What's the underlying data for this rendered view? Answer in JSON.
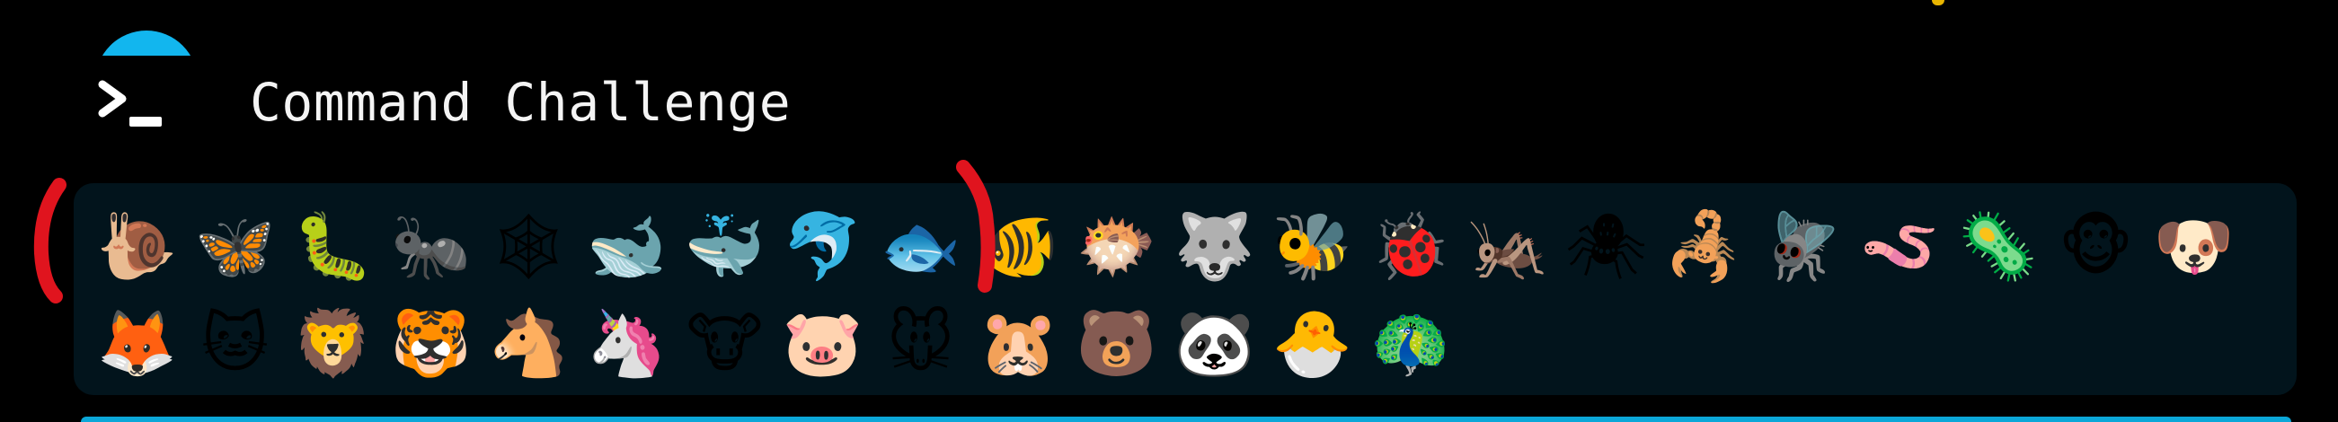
{
  "app": {
    "title": "Command Challenge",
    "icon": "terminal-prompt-icon"
  },
  "emoji_panel": {
    "row1": [
      {
        "name": "snail",
        "glyph": "🐌"
      },
      {
        "name": "butterfly",
        "glyph": "🦋"
      },
      {
        "name": "caterpillar",
        "glyph": "🐛"
      },
      {
        "name": "ant",
        "glyph": "🐜"
      },
      {
        "name": "spider-web",
        "glyph": "🕸"
      },
      {
        "name": "whale",
        "glyph": "🐋"
      },
      {
        "name": "spouting-whale",
        "glyph": "🐳"
      },
      {
        "name": "dolphin",
        "glyph": "🐬"
      },
      {
        "name": "fish",
        "glyph": "🐟"
      },
      {
        "name": "tropical-fish",
        "glyph": "🐠"
      },
      {
        "name": "blowfish",
        "glyph": "🐡"
      },
      {
        "name": "wolf",
        "glyph": "🐺"
      },
      {
        "name": "bee",
        "glyph": "🐝"
      },
      {
        "name": "ladybug",
        "glyph": "🐞"
      },
      {
        "name": "cricket",
        "glyph": "🦗"
      },
      {
        "name": "spider",
        "glyph": "🕷"
      },
      {
        "name": "scorpion",
        "glyph": "🦂"
      },
      {
        "name": "fly",
        "glyph": "🪰"
      },
      {
        "name": "worm",
        "glyph": "🪱"
      },
      {
        "name": "microbe",
        "glyph": "🦠"
      },
      {
        "name": "monkey-face",
        "glyph": "🐵"
      },
      {
        "name": "dog-face",
        "glyph": "🐶"
      }
    ],
    "row2": [
      {
        "name": "fox",
        "glyph": "🦊"
      },
      {
        "name": "cat-face",
        "glyph": "🐱"
      },
      {
        "name": "lion",
        "glyph": "🦁"
      },
      {
        "name": "tiger-face",
        "glyph": "🐯"
      },
      {
        "name": "horse-face",
        "glyph": "🐴"
      },
      {
        "name": "unicorn",
        "glyph": "🦄"
      },
      {
        "name": "cow-face",
        "glyph": "🐮"
      },
      {
        "name": "pig-face",
        "glyph": "🐷"
      },
      {
        "name": "mouse-face",
        "glyph": "🐭"
      },
      {
        "name": "hamster",
        "glyph": "🐹"
      },
      {
        "name": "bear",
        "glyph": "🐻"
      },
      {
        "name": "panda",
        "glyph": "🐼"
      },
      {
        "name": "hatching-chick",
        "glyph": "🐣"
      },
      {
        "name": "peacock",
        "glyph": "🦚"
      }
    ]
  },
  "colors": {
    "background": "#000000",
    "panel": "#02141c",
    "accent": "#12b6ee",
    "annotation_red": "#e0141e",
    "title_text": "#f4f4f4"
  }
}
